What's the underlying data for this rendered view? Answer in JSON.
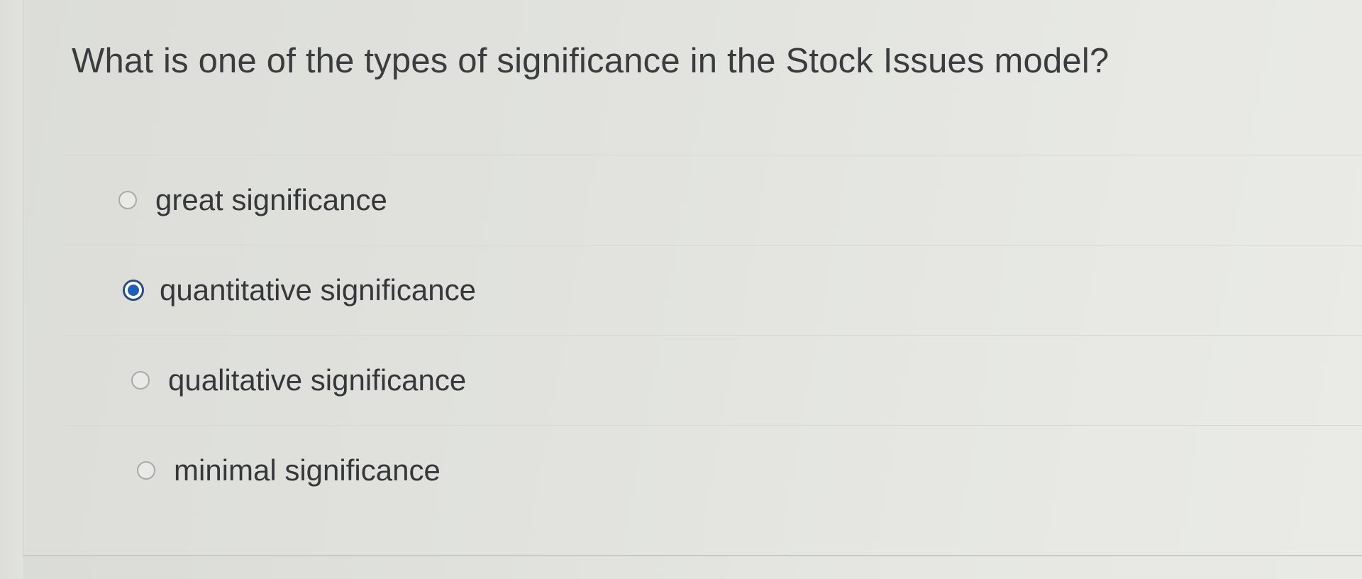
{
  "question": {
    "text": "What is one of the types of significance in the Stock Issues model?"
  },
  "options": [
    {
      "label": "great significance",
      "selected": false
    },
    {
      "label": "quantitative significance",
      "selected": true
    },
    {
      "label": "qualitative significance",
      "selected": false
    },
    {
      "label": "minimal significance",
      "selected": false
    }
  ],
  "colors": {
    "selected_radio": "#1f5fb8",
    "text": "#36373a"
  }
}
